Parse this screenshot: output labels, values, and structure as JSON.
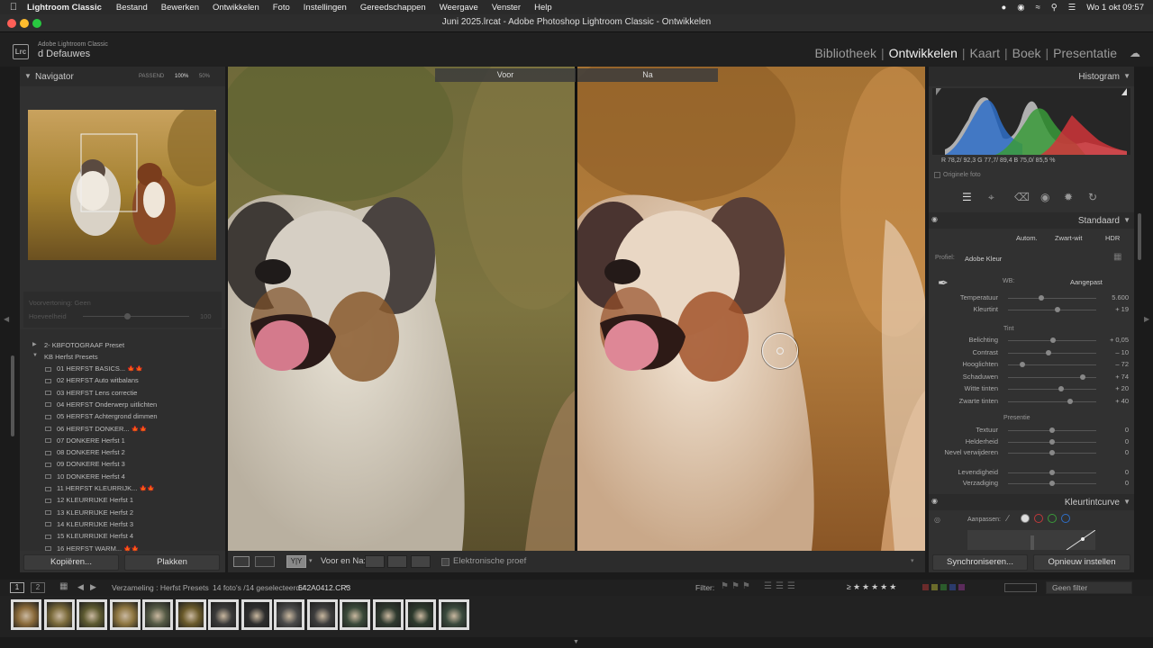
{
  "menubar": {
    "app": "Lightroom Classic",
    "items": [
      "Bestand",
      "Bewerken",
      "Ontwikkelen",
      "Foto",
      "Instellingen",
      "Gereedschappen",
      "Weergave",
      "Venster",
      "Help"
    ],
    "datetime": "Wo 1 okt 09:57"
  },
  "window": {
    "title": "Juni 2025.lrcat - Adobe Photoshop Lightroom Classic - Ontwikkelen"
  },
  "identity": {
    "logo": "Lrc",
    "product": "Adobe Lightroom Classic",
    "user": "d Defauwes"
  },
  "modules": {
    "items": [
      "Bibliotheek",
      "Ontwikkelen",
      "Kaart",
      "Boek",
      "Presentatie"
    ],
    "active": "Ontwikkelen"
  },
  "navigator": {
    "title": "Navigator",
    "zoom_fit": "PASSEND",
    "zoom_100": "100%",
    "zoom_50": "50%"
  },
  "preview": {
    "label": "Voorvertoning: Geen",
    "amount_label": "Hoeveelheid",
    "amount": "100"
  },
  "presets": {
    "groups": [
      {
        "name": "2- KBFOTOGRAAF Preset",
        "collapsed": true
      },
      {
        "name": "KB Herfst Presets",
        "collapsed": false
      }
    ],
    "items": [
      {
        "name": "01 HERFST BASICS...",
        "icons": "🍁🍁"
      },
      {
        "name": "02 HERFST Auto witbalans",
        "icons": ""
      },
      {
        "name": "03 HERFST Lens correctie",
        "icons": ""
      },
      {
        "name": "04 HERFST Onderwerp uitlichten",
        "icons": ""
      },
      {
        "name": "05 HERFST Achtergrond dimmen",
        "icons": ""
      },
      {
        "name": "06 HERFST DONKER...",
        "icons": "🍁🍁"
      },
      {
        "name": "07 DONKERE Herfst 1",
        "icons": ""
      },
      {
        "name": "08 DONKERE Herfst 2",
        "icons": ""
      },
      {
        "name": "09 DONKERE Herfst 3",
        "icons": ""
      },
      {
        "name": "10 DONKERE Herfst 4",
        "icons": ""
      },
      {
        "name": "11 HERFST KLEURRIJK...",
        "icons": "🍁🍁"
      },
      {
        "name": "12 KLEURRIJKE Herfst 1",
        "icons": ""
      },
      {
        "name": "13 KLEURRIJKE Herfst 2",
        "icons": ""
      },
      {
        "name": "14 KLEURRIJKE Herfst 3",
        "icons": ""
      },
      {
        "name": "15 KLEURRIJKE Herfst 4",
        "icons": ""
      },
      {
        "name": "16 HERFST WARM...",
        "icons": "🍁🍁"
      }
    ]
  },
  "left_buttons": {
    "copy": "Kopiëren...",
    "paste": "Plakken"
  },
  "compare": {
    "before": "Voor",
    "after": "Na"
  },
  "toolbar": {
    "before_after_label": "Voor en Na:",
    "proof_label": "Elektronische proef"
  },
  "histogram": {
    "title": "Histogram",
    "readout": "R  78,2/ 92,3   G  77,7/ 89,4   B  75,0/ 85,5  %",
    "original_label": "Originele foto"
  },
  "basic": {
    "title": "Standaard",
    "treatment": [
      "Autom.",
      "Zwart-wit",
      "HDR"
    ],
    "profile_label": "Profiel:",
    "profile_value": "Adobe Kleur",
    "wb_label": "WB:",
    "wb_value": "Aangepast",
    "sliders_wb": [
      {
        "label": "Temperatuur",
        "value": "5.600",
        "pos": 0.38
      },
      {
        "label": "Kleurtint",
        "value": "+ 19",
        "pos": 0.56
      }
    ],
    "tone_title": "Tint",
    "sliders_tone": [
      {
        "label": "Belichting",
        "value": "+ 0,05",
        "pos": 0.51
      },
      {
        "label": "Contrast",
        "value": "– 10",
        "pos": 0.46
      },
      {
        "label": "Hooglichten",
        "value": "– 72",
        "pos": 0.16
      },
      {
        "label": "Schaduwen",
        "value": "+ 74",
        "pos": 0.85
      },
      {
        "label": "Witte tinten",
        "value": "+ 20",
        "pos": 0.6
      },
      {
        "label": "Zwarte tinten",
        "value": "+ 40",
        "pos": 0.7
      }
    ],
    "presence_title": "Presentie",
    "sliders_presence": [
      {
        "label": "Textuur",
        "value": "0",
        "pos": 0.5
      },
      {
        "label": "Helderheid",
        "value": "0",
        "pos": 0.5
      },
      {
        "label": "Nevel verwijderen",
        "value": "0",
        "pos": 0.5
      },
      {
        "label": "Levendigheid",
        "value": "0",
        "pos": 0.5
      },
      {
        "label": "Verzadiging",
        "value": "0",
        "pos": 0.5
      }
    ]
  },
  "tonecurve": {
    "title": "Kleurtintcurve",
    "adjust_label": "Aanpassen:"
  },
  "right_buttons": {
    "sync": "Synchroniseren...",
    "reset": "Opnieuw instellen"
  },
  "filmstrip": {
    "collection": "Verzameling : Herfst Presets",
    "count": "14 foto's /14 geselecteerd /",
    "filename": "642A0412.CR3",
    "filter_label": "Filter:",
    "filter_value": "Geen filter",
    "screen1": "1",
    "screen2": "2",
    "thumb_count": 14
  },
  "colors": {
    "panel": "#313131",
    "accent_red": "#d0353a",
    "accent_green": "#3a9a3a",
    "accent_blue": "#2f6fc8"
  }
}
